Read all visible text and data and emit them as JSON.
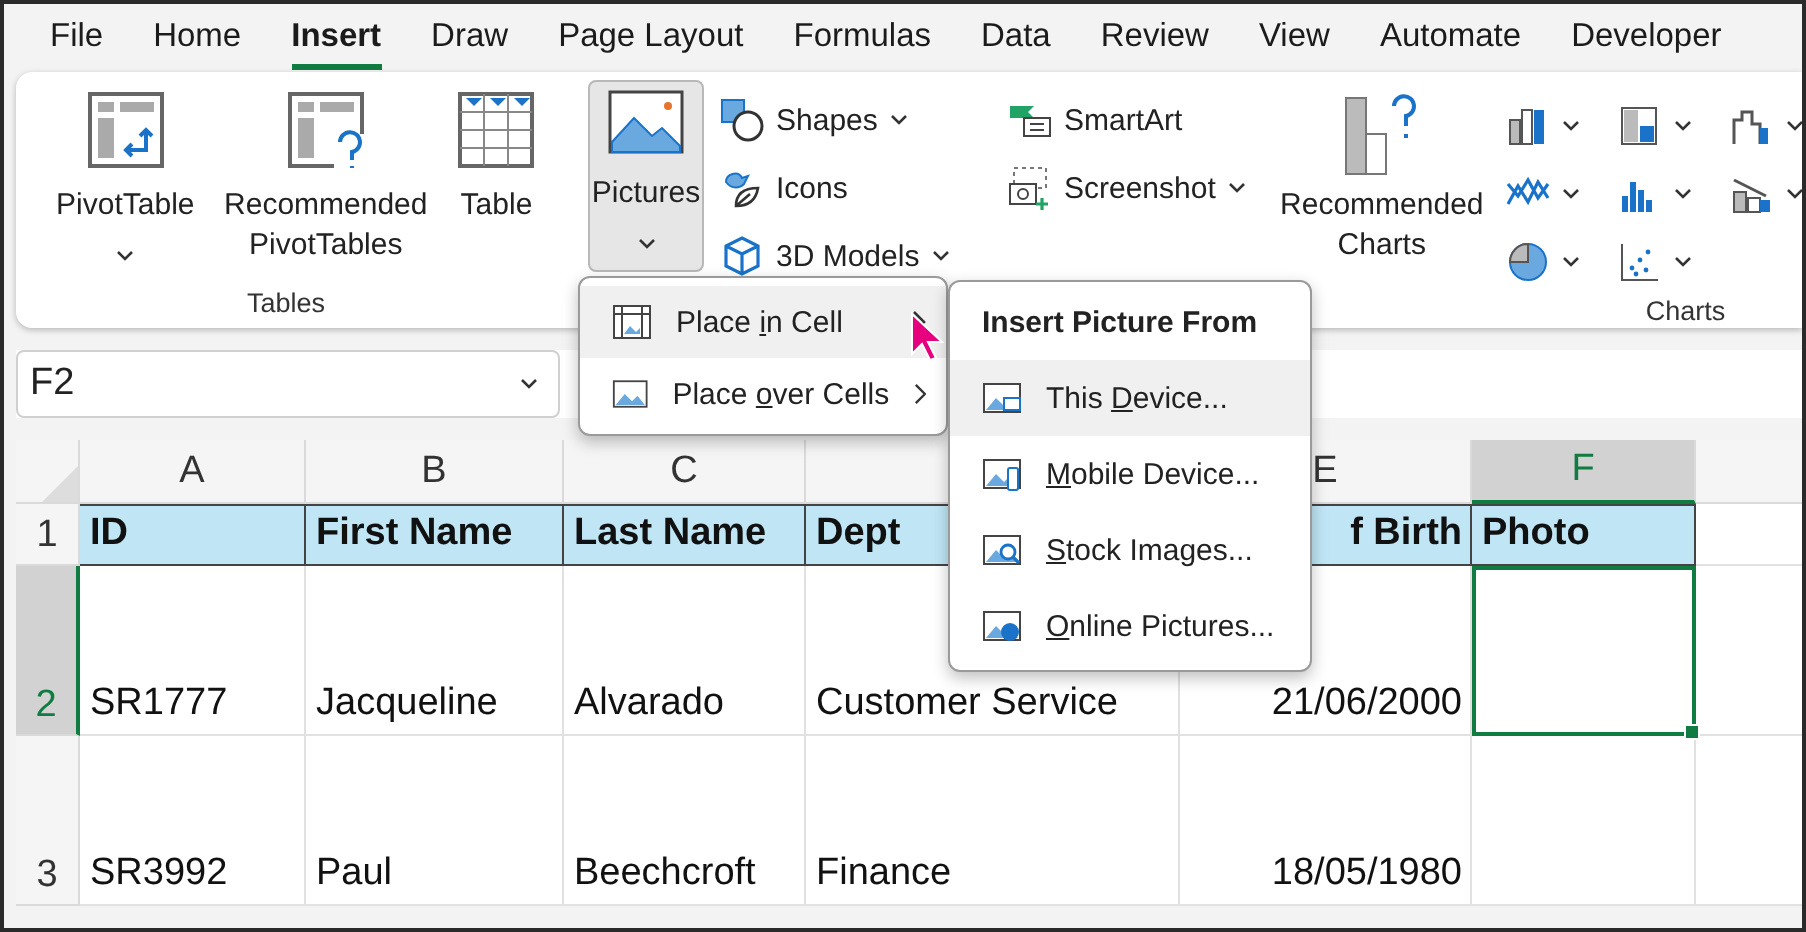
{
  "menu_tabs": [
    {
      "label": "File",
      "selected": false
    },
    {
      "label": "Home",
      "selected": false
    },
    {
      "label": "Insert",
      "selected": true
    },
    {
      "label": "Draw",
      "selected": false
    },
    {
      "label": "Page Layout",
      "selected": false
    },
    {
      "label": "Formulas",
      "selected": false
    },
    {
      "label": "Data",
      "selected": false
    },
    {
      "label": "Review",
      "selected": false
    },
    {
      "label": "View",
      "selected": false
    },
    {
      "label": "Automate",
      "selected": false
    },
    {
      "label": "Developer",
      "selected": false
    }
  ],
  "ribbon": {
    "tables": {
      "title": "Tables",
      "buttons": [
        {
          "kind": "pivot",
          "label": "PivotTable",
          "dropdown": true
        },
        {
          "kind": "recommended-pivot",
          "label": "Recommended PivotTables",
          "dropdown": false
        },
        {
          "kind": "table",
          "label": "Table",
          "dropdown": false
        }
      ]
    },
    "illustrations": {
      "pictures": {
        "label": "Pictures",
        "pressed": true,
        "dropdown": true
      },
      "small_buttons": [
        {
          "kind": "shapes",
          "label": "Shapes",
          "dropdown": true
        },
        {
          "kind": "icons",
          "label": "Icons",
          "dropdown": false
        },
        {
          "kind": "models",
          "label": "3D Models",
          "dropdown": true
        },
        {
          "kind": "smartart",
          "label": "SmartArt",
          "dropdown": false
        },
        {
          "kind": "screenshot",
          "label": "Screenshot",
          "dropdown": true
        }
      ]
    },
    "charts": {
      "title": "Charts",
      "recommended": {
        "label": "Recommended Charts"
      }
    }
  },
  "name_box": {
    "value": "F2"
  },
  "columns": [
    {
      "letter": "A",
      "selected": false
    },
    {
      "letter": "B",
      "selected": false
    },
    {
      "letter": "C",
      "selected": false
    },
    {
      "selected": false
    },
    {
      "letter": "E",
      "selected": false
    },
    {
      "letter": "F",
      "selected": true
    },
    {
      "selected": false
    }
  ],
  "rows": [
    {
      "number": "1",
      "kind": "header",
      "selected": false,
      "cells": [
        {
          "text": "ID"
        },
        {
          "text": "First Name"
        },
        {
          "text": "Last Name"
        },
        {
          "text": "Dept"
        },
        {
          "text": "f Birth"
        },
        {
          "text": "Photo"
        }
      ]
    },
    {
      "number": "2",
      "kind": "data",
      "selected": true,
      "cells": [
        {
          "text": "SR1777"
        },
        {
          "text": "Jacqueline"
        },
        {
          "text": "Alvarado"
        },
        {
          "text": "Customer Service"
        },
        {
          "text": "21/06/2000"
        },
        {
          "active": true
        }
      ]
    },
    {
      "number": "3",
      "kind": "data",
      "selected": false,
      "cells": [
        {
          "text": "SR3992"
        },
        {
          "text": "Paul"
        },
        {
          "text": "Beechcroft"
        },
        {
          "text": "Finance"
        },
        {
          "text": "18/05/1980"
        },
        {
          "active": false
        }
      ]
    }
  ],
  "pictures_menu": {
    "items": [
      {
        "kind": "cell",
        "selected": true,
        "label_parts": [
          {
            "t": "Place "
          },
          {
            "t": "i",
            "key": true
          },
          {
            "t": "n Cell"
          }
        ]
      },
      {
        "kind": "over",
        "selected": false,
        "label_parts": [
          {
            "t": "Place "
          },
          {
            "t": "o",
            "key": true
          },
          {
            "t": "ver Cells"
          }
        ]
      }
    ]
  },
  "submenu": {
    "title": "Insert Picture From",
    "items": [
      {
        "kind": "device",
        "selected": true,
        "label_parts": [
          {
            "t": "This "
          },
          {
            "t": "D",
            "key": true
          },
          {
            "t": "evice..."
          }
        ]
      },
      {
        "kind": "mobile",
        "selected": false,
        "label_parts": [
          {
            "t": "M",
            "key": true
          },
          {
            "t": "obile Device..."
          }
        ]
      },
      {
        "kind": "stock",
        "selected": false,
        "label_parts": [
          {
            "t": "S",
            "key": true
          },
          {
            "t": "tock Images..."
          }
        ]
      },
      {
        "kind": "online",
        "selected": false,
        "label_parts": [
          {
            "t": "O",
            "key": true
          },
          {
            "t": "nline Pictures..."
          }
        ]
      }
    ]
  }
}
